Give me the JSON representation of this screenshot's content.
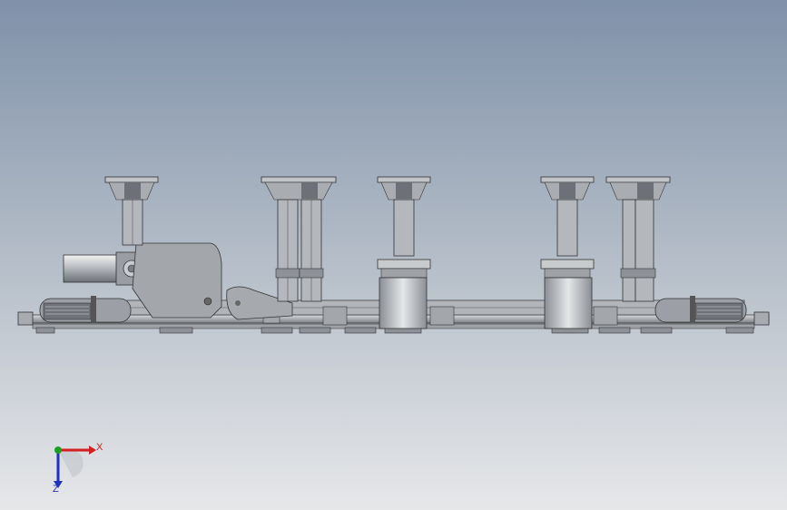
{
  "viewport": {
    "background_top": "#7f91a9",
    "background_bottom": "#e6e7e9",
    "model_color": "#b9bdc2"
  },
  "triad": {
    "x_label": "X",
    "z_label": "Z",
    "x_color": "#d42020",
    "y_color": "#1aa020",
    "z_color": "#2030c0"
  }
}
